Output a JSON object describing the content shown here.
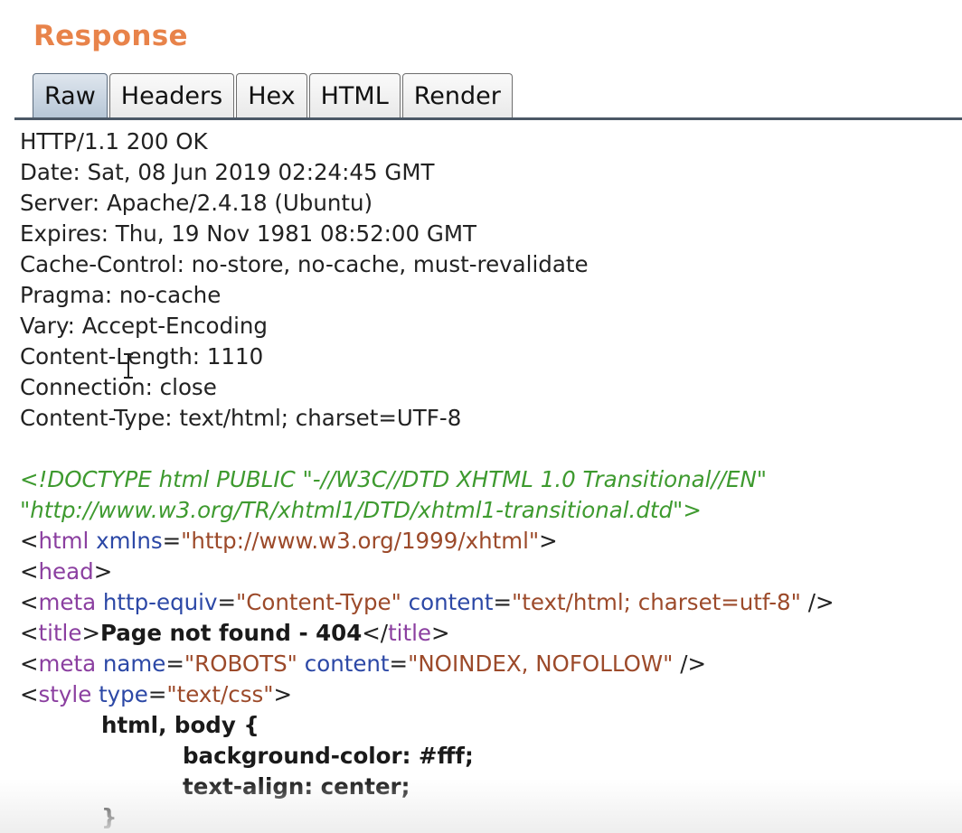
{
  "panel": {
    "title": "Response"
  },
  "tabs": [
    {
      "label": "Raw",
      "active": true
    },
    {
      "label": "Headers",
      "active": false
    },
    {
      "label": "Hex",
      "active": false
    },
    {
      "label": "HTML",
      "active": false
    },
    {
      "label": "Render",
      "active": false
    }
  ],
  "headers": [
    "HTTP/1.1 200 OK",
    "Date: Sat, 08 Jun 2019 02:24:45 GMT",
    "Server: Apache/2.4.18 (Ubuntu)",
    "Expires: Thu, 19 Nov 1981 08:52:00 GMT",
    "Cache-Control: no-store, no-cache, must-revalidate",
    "Pragma: no-cache",
    "Vary: Accept-Encoding",
    "Content-Length: 1110",
    "Connection: close",
    "Content-Type: text/html; charset=UTF-8"
  ],
  "body": {
    "doctype_1": "<!DOCTYPE html PUBLIC \"-//W3C//DTD XHTML 1.0 Transitional//EN\"",
    "doctype_2": "\"http://www.w3.org/TR/xhtml1/DTD/xhtml1-transitional.dtd\">",
    "html_tag": "html",
    "html_attr": "xmlns",
    "html_val": "\"http://www.w3.org/1999/xhtml\"",
    "head_tag": "head",
    "meta1_tag": "meta",
    "meta1_attr1": "http-equiv",
    "meta1_val1": "\"Content-Type\"",
    "meta1_attr2": "content",
    "meta1_val2": "\"text/html; charset=utf-8\"",
    "title_tag": "title",
    "title_text": "Page not found - 404",
    "meta2_tag": "meta",
    "meta2_attr1": "name",
    "meta2_val1": "\"ROBOTS\"",
    "meta2_attr2": "content",
    "meta2_val2": "\"NOINDEX, NOFOLLOW\"",
    "style_tag": "style",
    "style_attr": "type",
    "style_val": "\"text/css\"",
    "css_selector": "html, body {",
    "css_rule1": "background-color: #fff;",
    "css_rule2": "text-align: center;",
    "css_close": "}"
  },
  "colors": {
    "title": "#e8834a",
    "doctype": "#3e9a2f",
    "tag": "#8b3fa0",
    "attr": "#2c48a6",
    "value": "#9c4a2a"
  }
}
